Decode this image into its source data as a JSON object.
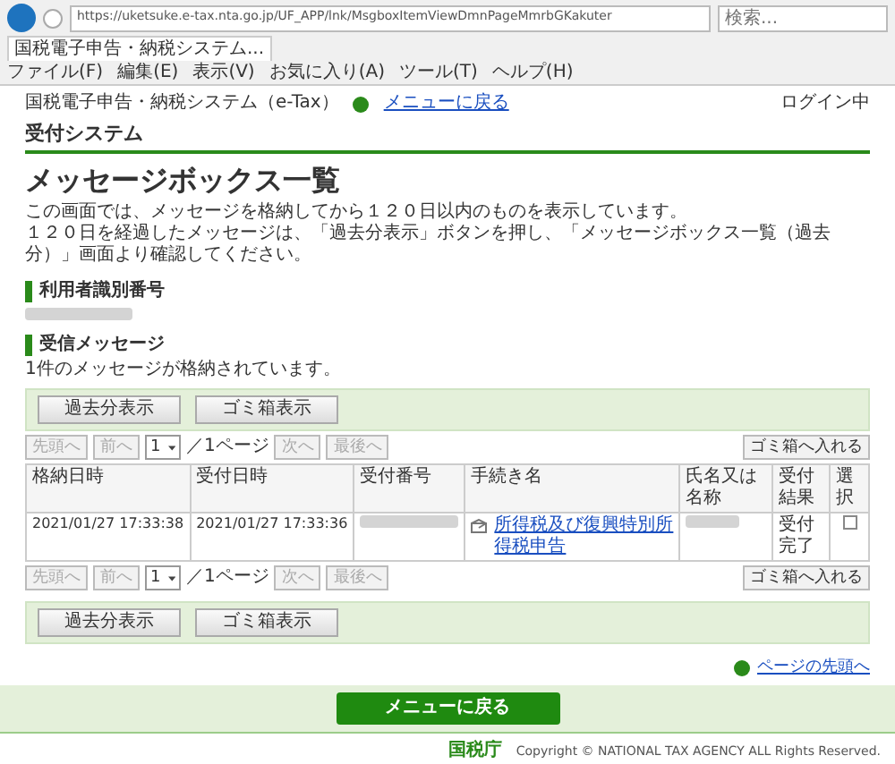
{
  "browser": {
    "url": "https://uketsuke.e-tax.nta.go.jp/UF_APP/lnk/MsgboxItemViewDmnPageMmrbGKakuter",
    "search_placeholder": "検索...",
    "tab_title": "国税電子申告・納税システム...",
    "menu": [
      "ファイル(F)",
      "編集(E)",
      "表示(V)",
      "お気に入り(A)",
      "ツール(T)",
      "ヘルプ(H)"
    ]
  },
  "header": {
    "system_name": "国税電子申告・納税システム（e-Tax）",
    "menu_link": "メニューに戻る",
    "login_status": "ログイン中",
    "subsystem": "受付システム"
  },
  "page_title": "メッセージボックス一覧",
  "description": [
    "この画面では、メッセージを格納してから１２０日以内のものを表示しています。",
    "１２０日を経過したメッセージは、「過去分表示」ボタンを押し、「メッセージボックス一覧（過去分）」画面より確認してください。"
  ],
  "user_id_section": {
    "heading": "利用者識別番号"
  },
  "messages_section": {
    "heading": "受信メッセージ",
    "count_text": "1件のメッセージが格納されています。"
  },
  "action_bars": [
    {
      "buttons": [
        "過去分表示",
        "ゴミ箱表示"
      ]
    },
    {
      "buttons": [
        "過去分表示",
        "ゴミ箱表示"
      ]
    }
  ],
  "pagers": [
    {
      "buttons": [
        {
          "label": "先頭へ",
          "disabled": true
        },
        {
          "label": "前へ",
          "disabled": true
        }
      ],
      "page_select": "1",
      "page_total": "／1ページ",
      "next_buttons": [
        {
          "label": "次へ",
          "disabled": true
        },
        {
          "label": "最後へ",
          "disabled": true
        }
      ],
      "trash_button": "ゴミ箱へ入れる"
    },
    {
      "buttons": [
        {
          "label": "先頭へ",
          "disabled": true
        },
        {
          "label": "前へ",
          "disabled": true
        }
      ],
      "page_select": "1",
      "page_total": "／1ページ",
      "next_buttons": [
        {
          "label": "次へ",
          "disabled": true
        },
        {
          "label": "最後へ",
          "disabled": true
        }
      ],
      "trash_button": "ゴミ箱へ入れる"
    }
  ],
  "table": {
    "columns": [
      "格納日時",
      "受付日時",
      "受付番号",
      "手続き名",
      "氏名又は名称",
      "受付結果",
      "選択"
    ],
    "rows": [
      {
        "stored": "2021/01/27 17:33:38",
        "received": "2021/01/27 17:33:36",
        "procedure": "所得税及び復興特別所得税申告",
        "result": "受付完了",
        "selected": false
      }
    ]
  },
  "page_top_link": "ページの先頭へ",
  "footer": {
    "button": "メニューに戻る",
    "agency": "国税庁",
    "copyright": "Copyright © NATIONAL TAX AGENCY ALL Rights Reserved."
  }
}
